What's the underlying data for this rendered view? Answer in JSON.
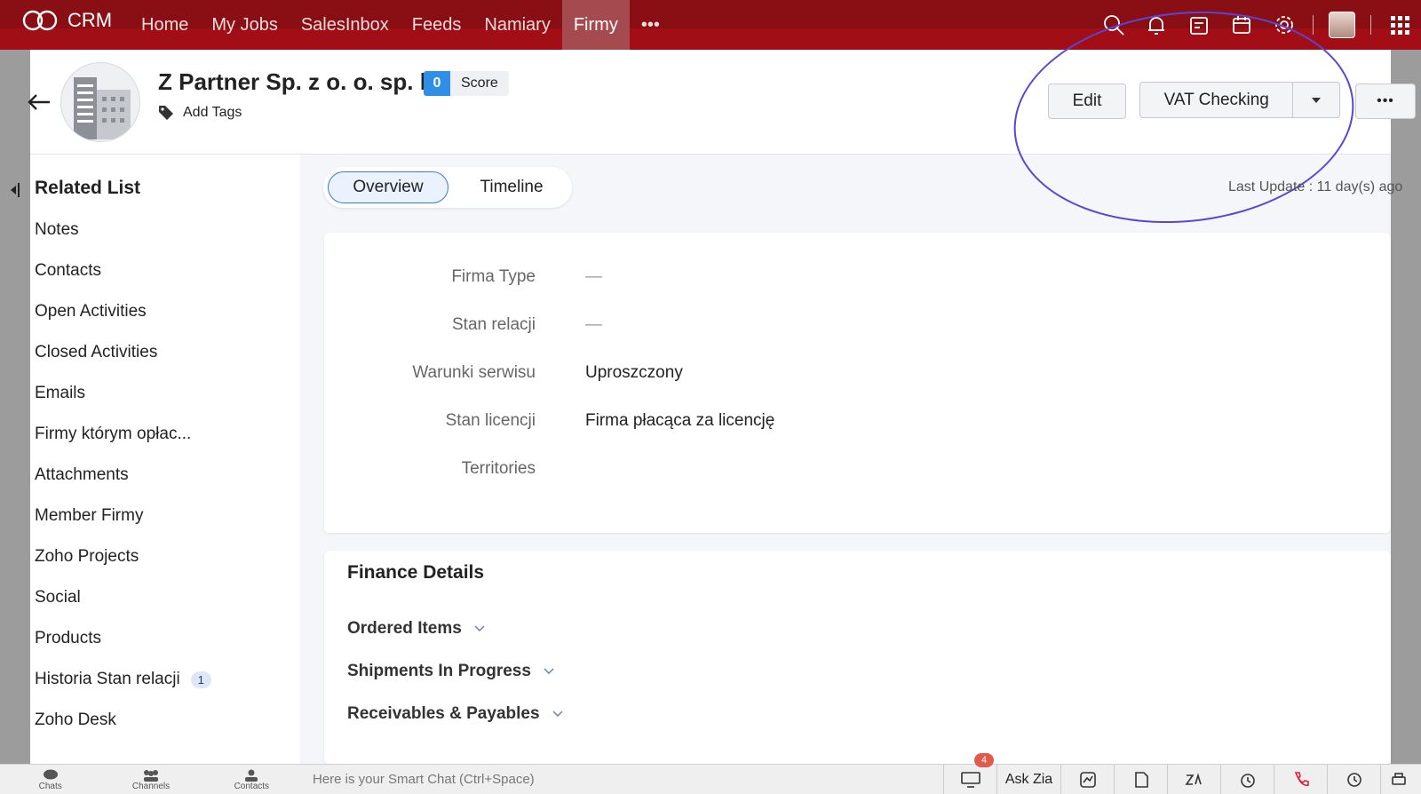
{
  "app": {
    "logo_text": "CRM"
  },
  "nav": {
    "items": [
      "Home",
      "My Jobs",
      "SalesInbox",
      "Feeds",
      "Namiary",
      "Firmy"
    ],
    "more": "•••",
    "active": "Firmy"
  },
  "top_icons": [
    "search-icon",
    "bell-icon",
    "notes-icon",
    "calendar-icon",
    "gear-icon",
    "avatar",
    "apps-grid-icon"
  ],
  "record": {
    "title": "Z Partner Sp. z o. o. sp. k.",
    "score_value": "0",
    "score_label": "Score",
    "add_tags": "Add Tags"
  },
  "actions": {
    "edit": "Edit",
    "vat": "VAT Checking",
    "more": "•••"
  },
  "related_list": {
    "title": "Related List",
    "items": [
      {
        "label": "Notes"
      },
      {
        "label": "Contacts"
      },
      {
        "label": "Open Activities"
      },
      {
        "label": "Closed Activities"
      },
      {
        "label": "Emails"
      },
      {
        "label": "Firmy którym opłac..."
      },
      {
        "label": "Attachments"
      },
      {
        "label": "Member Firmy"
      },
      {
        "label": "Zoho Projects"
      },
      {
        "label": "Social"
      },
      {
        "label": "Products"
      },
      {
        "label": "Historia Stan relacji",
        "badge": "1"
      },
      {
        "label": "Zoho Desk"
      }
    ]
  },
  "tabs": {
    "overview": "Overview",
    "timeline": "Timeline"
  },
  "last_update": "Last Update : 11 day(s) ago",
  "overview_fields": [
    {
      "label": "Firma Type",
      "value": "—"
    },
    {
      "label": "Stan relacji",
      "value": "—"
    },
    {
      "label": "Warunki serwisu",
      "value": "Uproszczony"
    },
    {
      "label": "Stan licencji",
      "value": "Firma płacąca za licencję"
    },
    {
      "label": "Territories",
      "value": ""
    }
  ],
  "finance": {
    "title": "Finance Details",
    "sections": [
      "Ordered Items",
      "Shipments In Progress",
      "Receivables & Payables"
    ]
  },
  "bottom": {
    "chats": "Chats",
    "channels": "Channels",
    "contacts": "Contacts",
    "smart_chat_placeholder": "Here is your Smart Chat (Ctrl+Space)",
    "notif_count": "4",
    "ask_zia": "Ask Zia"
  }
}
